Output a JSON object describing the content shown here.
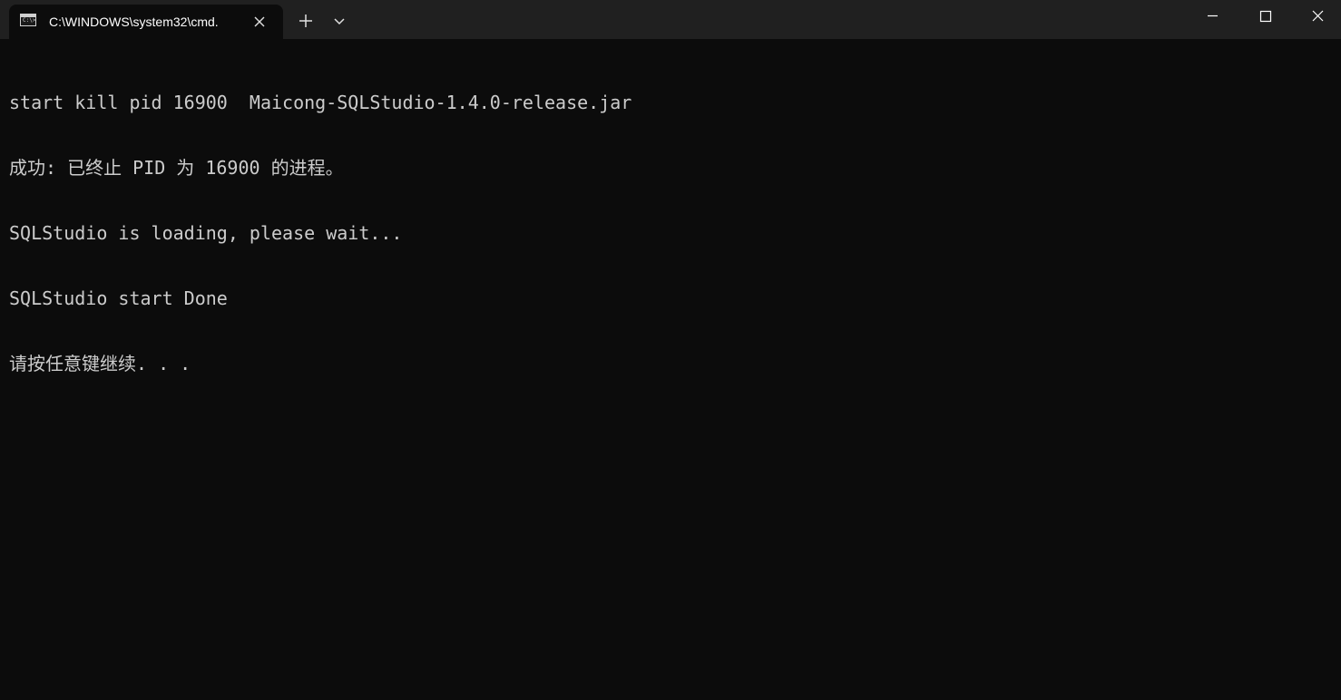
{
  "window": {
    "tab_title": "C:\\WINDOWS\\system32\\cmd.",
    "tab_icon_text": "C:\\>"
  },
  "console": {
    "lines": [
      "start kill pid 16900  Maicong-SQLStudio-1.4.0-release.jar",
      "成功: 已终止 PID 为 16900 的进程。",
      "SQLStudio is loading, please wait...",
      "SQLStudio start Done",
      "请按任意键继续. . ."
    ]
  },
  "icons": {
    "tab_icon": "terminal-icon",
    "tab_close": "close-icon",
    "new_tab": "plus-icon",
    "dropdown": "chevron-down-icon",
    "minimize": "minimize-icon",
    "maximize": "maximize-icon",
    "close": "close-icon"
  },
  "colors": {
    "background": "#0c0c0c",
    "titlebar": "#202020",
    "text": "#cccccc"
  }
}
